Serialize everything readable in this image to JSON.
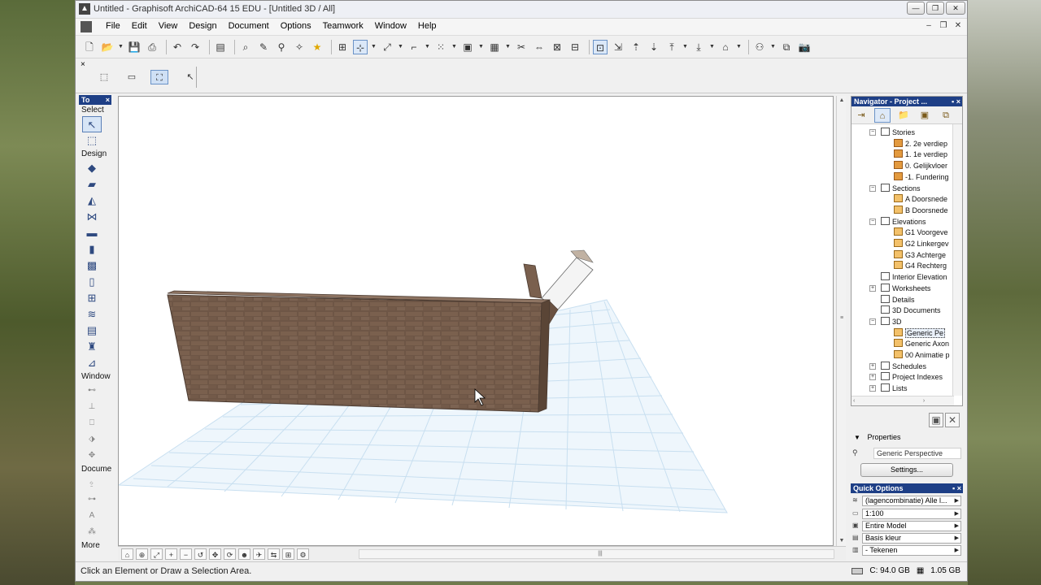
{
  "window": {
    "title": "Untitled - Graphisoft ArchiCAD-64 15 EDU - [Untitled 3D / All]",
    "app_icon": "archicad-logo"
  },
  "menubar": {
    "items": [
      "File",
      "Edit",
      "View",
      "Design",
      "Document",
      "Options",
      "Teamwork",
      "Window",
      "Help"
    ]
  },
  "toolbox": {
    "header": "To",
    "close": "×",
    "sections": {
      "select": "Select",
      "design": "Design",
      "window": "Window",
      "document": "Docume",
      "more": "More"
    }
  },
  "navigator": {
    "header": "Navigator - Project ...",
    "items": [
      {
        "label": "Stories",
        "level": 1,
        "icon": "box",
        "exp": "−"
      },
      {
        "label": "2. 2e verdiep",
        "level": 2,
        "icon": "story"
      },
      {
        "label": "1. 1e verdiep",
        "level": 2,
        "icon": "story"
      },
      {
        "label": "0. Gelijkvloer",
        "level": 2,
        "icon": "story"
      },
      {
        "label": "-1. Fundering",
        "level": 2,
        "icon": "story"
      },
      {
        "label": "Sections",
        "level": 1,
        "icon": "box",
        "exp": "−"
      },
      {
        "label": "A Doorsnede",
        "level": 2,
        "icon": "house"
      },
      {
        "label": "B Doorsnede",
        "level": 2,
        "icon": "house"
      },
      {
        "label": "Elevations",
        "level": 1,
        "icon": "box",
        "exp": "−"
      },
      {
        "label": "G1 Voorgeve",
        "level": 2,
        "icon": "house"
      },
      {
        "label": "G2 Linkergev",
        "level": 2,
        "icon": "house"
      },
      {
        "label": "G3 Achterge",
        "level": 2,
        "icon": "house"
      },
      {
        "label": "G4 Rechterg",
        "level": 2,
        "icon": "house"
      },
      {
        "label": "Interior Elevation",
        "level": 1,
        "icon": "box",
        "exp": ""
      },
      {
        "label": "Worksheets",
        "level": 1,
        "icon": "box",
        "exp": "+"
      },
      {
        "label": "Details",
        "level": 1,
        "icon": "box",
        "exp": ""
      },
      {
        "label": "3D Documents",
        "level": 1,
        "icon": "box",
        "exp": ""
      },
      {
        "label": "3D",
        "level": 1,
        "icon": "box",
        "exp": "−"
      },
      {
        "label": "Generic Pe",
        "level": 2,
        "icon": "house",
        "selected": true
      },
      {
        "label": "Generic Axon",
        "level": 2,
        "icon": "house"
      },
      {
        "label": "00 Animatie p",
        "level": 2,
        "icon": "house"
      },
      {
        "label": "Schedules",
        "level": 1,
        "icon": "box",
        "exp": "+"
      },
      {
        "label": "Project Indexes",
        "level": 1,
        "icon": "box",
        "exp": "+"
      },
      {
        "label": "Lists",
        "level": 1,
        "icon": "box",
        "exp": "+"
      }
    ]
  },
  "properties": {
    "title": "Properties",
    "value": "Generic Perspective",
    "settings_button": "Settings..."
  },
  "quick_options": {
    "header": "Quick Options",
    "rows": [
      "(lagencombinatie) Alle l...",
      "1:100",
      "Entire Model",
      "Basis kleur",
      "- Tekenen"
    ]
  },
  "status": {
    "message": "Click an Element or Draw a Selection Area.",
    "disk": "C: 94.0 GB",
    "memory": "1.05 GB"
  },
  "colors": {
    "panel_header": "#1e3f86",
    "wall_brick": "#6e5646",
    "grid_line": "#c8dff0"
  }
}
